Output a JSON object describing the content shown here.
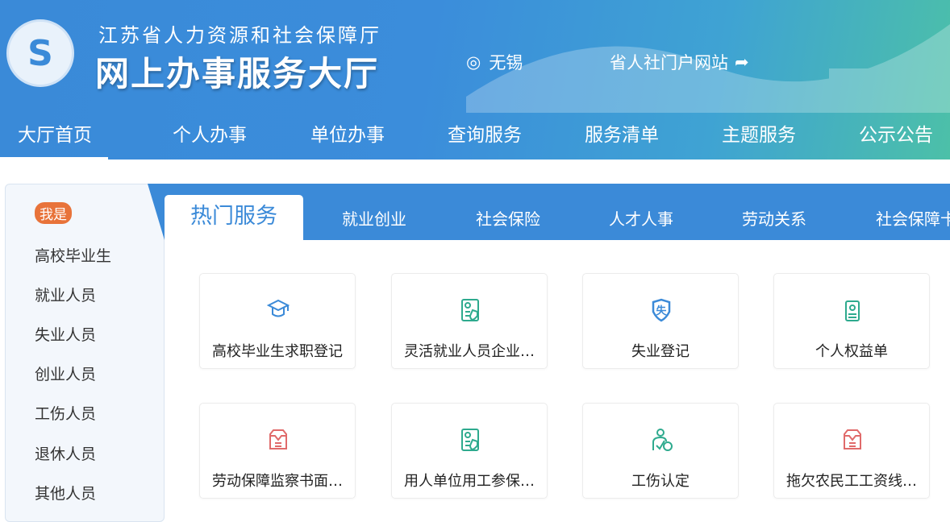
{
  "header": {
    "org_name": "江苏省人力资源和社会保障厅",
    "title": "网上办事服务大厅",
    "location": "无锡",
    "portal_link": "省人社门户网站",
    "logo_text": "江苏省人力资源和社会保障厅"
  },
  "nav": {
    "items": [
      {
        "label": "大厅首页",
        "active": true
      },
      {
        "label": "个人办事"
      },
      {
        "label": "单位办事"
      },
      {
        "label": "查询服务"
      },
      {
        "label": "服务清单"
      },
      {
        "label": "主题服务"
      },
      {
        "label": "公示公告"
      }
    ]
  },
  "sidebar": {
    "badge": "我是",
    "items": [
      "高校毕业生",
      "就业人员",
      "失业人员",
      "创业人员",
      "工伤人员",
      "退休人员",
      "其他人员"
    ]
  },
  "tabs": {
    "active": "热门服务",
    "items": [
      "就业创业",
      "社会保险",
      "人才人事",
      "劳动关系",
      "社会保障卡"
    ]
  },
  "cards": [
    {
      "label": "高校毕业生求职登记",
      "icon": "graduation-cap-icon",
      "color": "#3b8ad8"
    },
    {
      "label": "灵活就业人员企业…",
      "icon": "id-card-shield-icon",
      "color": "#2eaa8e"
    },
    {
      "label": "失业登记",
      "icon": "unemployment-shield-icon",
      "color": "#3b8ad8"
    },
    {
      "label": "个人权益单",
      "icon": "clipboard-person-icon",
      "color": "#2eaa8e"
    },
    {
      "label": "劳动保障监察书面…",
      "icon": "inbox-tray-icon",
      "color": "#e06a6a"
    },
    {
      "label": "用人单位用工参保…",
      "icon": "id-card-check-icon",
      "color": "#2eaa8e"
    },
    {
      "label": "工伤认定",
      "icon": "injured-person-icon",
      "color": "#2eaa8e"
    },
    {
      "label": "拖欠农民工工资线…",
      "icon": "inbox-tray-icon",
      "color": "#e06a6a"
    }
  ]
}
